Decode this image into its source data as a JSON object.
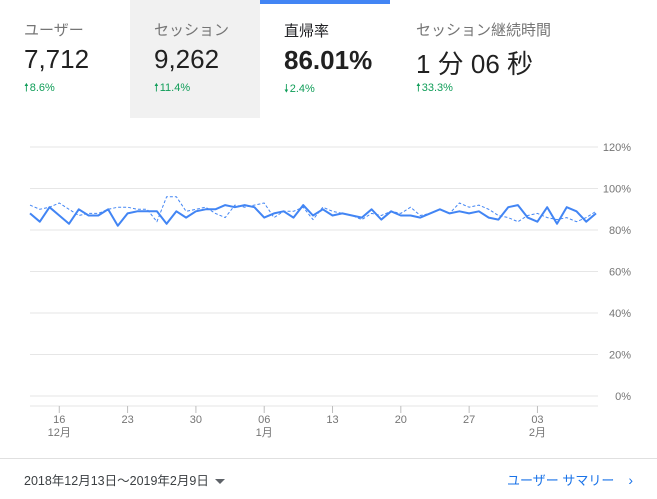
{
  "metrics": [
    {
      "label": "ユーザー",
      "value": "7,712",
      "change": "8.6%",
      "direction": "up"
    },
    {
      "label": "セッション",
      "value": "9,262",
      "change": "11.4%",
      "direction": "up"
    },
    {
      "label": "直帰率",
      "value": "86.01%",
      "change": "2.4%",
      "direction": "down"
    },
    {
      "label": "セッション継続時間",
      "value": "1 分 06 秒",
      "change": "33.3%",
      "direction": "up"
    }
  ],
  "colors": {
    "accent": "#4285f4",
    "positive": "#0f9d58"
  },
  "chart_data": {
    "type": "line",
    "y_ticks": [
      "120%",
      "100%",
      "80%",
      "60%",
      "40%",
      "20%",
      "0%"
    ],
    "y_range": [
      0,
      120
    ],
    "x_ticks": [
      {
        "day": "16",
        "month": "12月"
      },
      {
        "day": "23",
        "month": ""
      },
      {
        "day": "30",
        "month": ""
      },
      {
        "day": "06",
        "month": "1月"
      },
      {
        "day": "13",
        "month": ""
      },
      {
        "day": "20",
        "month": ""
      },
      {
        "day": "27",
        "month": ""
      },
      {
        "day": "03",
        "month": "2月"
      }
    ],
    "series": [
      {
        "style": "solid",
        "values": [
          88,
          84,
          91,
          87,
          83,
          90,
          87,
          87,
          90,
          82,
          88,
          89,
          89,
          89,
          83,
          89,
          86,
          89,
          90,
          90,
          92,
          91,
          92,
          91,
          86,
          88,
          89,
          86,
          92,
          87,
          90,
          87,
          88,
          87,
          86,
          90,
          85,
          89,
          87,
          87,
          86,
          88,
          90,
          88,
          89,
          88,
          89,
          86,
          85,
          91,
          92,
          86,
          84,
          91,
          83,
          91,
          89,
          84,
          88
        ]
      },
      {
        "style": "dashed",
        "values": [
          92,
          90,
          91,
          93,
          90,
          87,
          88,
          88,
          90,
          91,
          91,
          90,
          90,
          84,
          96,
          96,
          89,
          90,
          91,
          88,
          86,
          92,
          91,
          92,
          93,
          86,
          89,
          89,
          91,
          85,
          91,
          89,
          88,
          87,
          85,
          88,
          87,
          89,
          88,
          91,
          87,
          88,
          90,
          88,
          93,
          91,
          92,
          90,
          87,
          86,
          84,
          87,
          88,
          86,
          85,
          86,
          84,
          86,
          89
        ]
      }
    ]
  },
  "footer": {
    "date_range": "2018年12月13日〜2019年2月9日",
    "summary_link": "ユーザー サマリー",
    "chevron": "›"
  }
}
